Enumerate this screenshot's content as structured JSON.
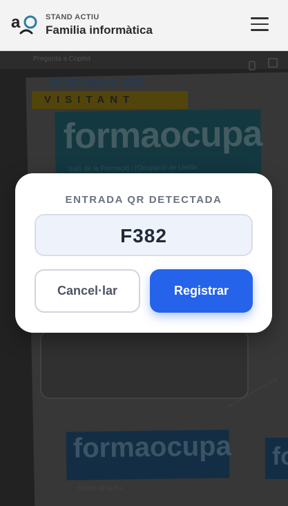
{
  "header": {
    "subtitle": "STAND ACTIU",
    "title": "Familia informàtica",
    "logo_text": "ao"
  },
  "camera": {
    "toolbar_text": "Pregunta a Copilot",
    "banner_top_text": "formaocupa",
    "banner_top_tagline": "Saló de la Formació i l'Ocupació de Lleida",
    "ticket_dates": "26-28 febrer 2026",
    "ticket_type": "VISITANT",
    "banner_bottom_text": "formaocupa",
    "banner_right_text": "fo",
    "bottom_label": "Dades de la fira"
  },
  "modal": {
    "title": "ENTRADA QR DETECTADA",
    "code": "F382",
    "cancel_label": "Cancel·lar",
    "register_label": "Registrar"
  },
  "colors": {
    "primary": "#2563eb",
    "header_bg": "#f3f3f3",
    "code_box_bg": "#eef2fb"
  }
}
